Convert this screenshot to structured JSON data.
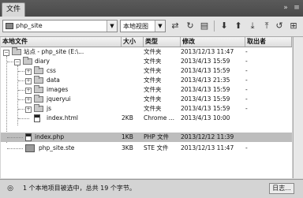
{
  "panel": {
    "tab_label": "文件"
  },
  "toolbar": {
    "site_value": "php_site",
    "view_value": "本地视图"
  },
  "columns": {
    "name": "本地文件",
    "size": "大小",
    "type": "类型",
    "modified": "修改",
    "checked_out": "取出者"
  },
  "rows": [
    {
      "name": "站点 - php_site (E:\\...",
      "size": "",
      "type": "文件夹",
      "modified": "2013/12/13 11:47",
      "checked_out": "-",
      "kind": "site"
    },
    {
      "name": "diary",
      "size": "",
      "type": "文件夹",
      "modified": "2013/4/13 15:59",
      "checked_out": "-",
      "kind": "folder"
    },
    {
      "name": "css",
      "size": "",
      "type": "文件夹",
      "modified": "2013/4/13 15:59",
      "checked_out": "-",
      "kind": "folder"
    },
    {
      "name": "data",
      "size": "",
      "type": "文件夹",
      "modified": "2013/4/13 21:35",
      "checked_out": "-",
      "kind": "folder"
    },
    {
      "name": "images",
      "size": "",
      "type": "文件夹",
      "modified": "2013/4/13 15:59",
      "checked_out": "-",
      "kind": "folder"
    },
    {
      "name": "jqueryui",
      "size": "",
      "type": "文件夹",
      "modified": "2013/4/13 15:59",
      "checked_out": "-",
      "kind": "folder"
    },
    {
      "name": "js",
      "size": "",
      "type": "文件夹",
      "modified": "2013/4/13 15:59",
      "checked_out": "-",
      "kind": "folder"
    },
    {
      "name": "index.html",
      "size": "2KB",
      "type": "Chrome ...",
      "modified": "2013/4/13 10:00",
      "checked_out": "",
      "kind": "file"
    },
    {
      "name": "index.php",
      "size": "1KB",
      "type": "PHP 文件",
      "modified": "2013/12/12 11:39",
      "checked_out": "",
      "kind": "file"
    },
    {
      "name": "php_site.ste",
      "size": "3KB",
      "type": "STE 文件",
      "modified": "2013/12/13 11:47",
      "checked_out": "-",
      "kind": "file"
    }
  ],
  "status": {
    "text": "1 个本地项目被选中，总共 19 个字节。",
    "log_label": "日志..."
  }
}
